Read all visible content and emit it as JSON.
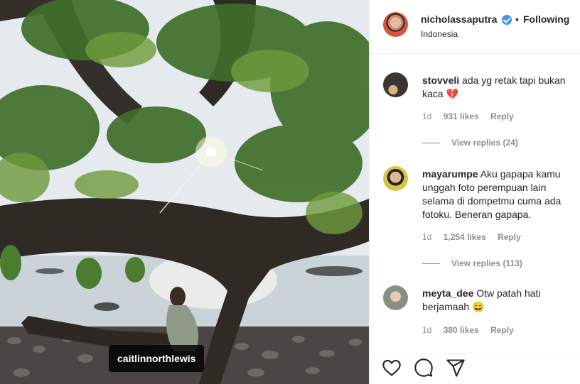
{
  "photo": {
    "tagged_user": "caitlinnorthlewis"
  },
  "post_header": {
    "username": "nicholassaputra",
    "verified_icon": "verified-badge-icon",
    "separator": "•",
    "follow_state": "Following",
    "location": "Indonesia"
  },
  "comments": [
    {
      "username": "stovveli",
      "text": "ada yg retak tapi bukan kaca 💔",
      "age": "1d",
      "likes": "931 likes",
      "reply": "Reply",
      "view_replies": "View replies (24)"
    },
    {
      "username": "mayarumpe",
      "text": "Aku gapapa kamu unggah foto perempuan lain selama di dompetmu cuma ada fotoku. Beneran gapapa.",
      "age": "1d",
      "likes": "1,254 likes",
      "reply": "Reply",
      "view_replies": "View replies (113)"
    },
    {
      "username": "meyta_dee",
      "text": "Otw patah hati berjamaah 😄",
      "age": "1d",
      "likes": "380 likes",
      "reply": "Reply"
    }
  ],
  "actions": {
    "like_icon": "heart-icon",
    "comment_icon": "comment-bubble-icon",
    "share_icon": "paper-plane-icon"
  }
}
